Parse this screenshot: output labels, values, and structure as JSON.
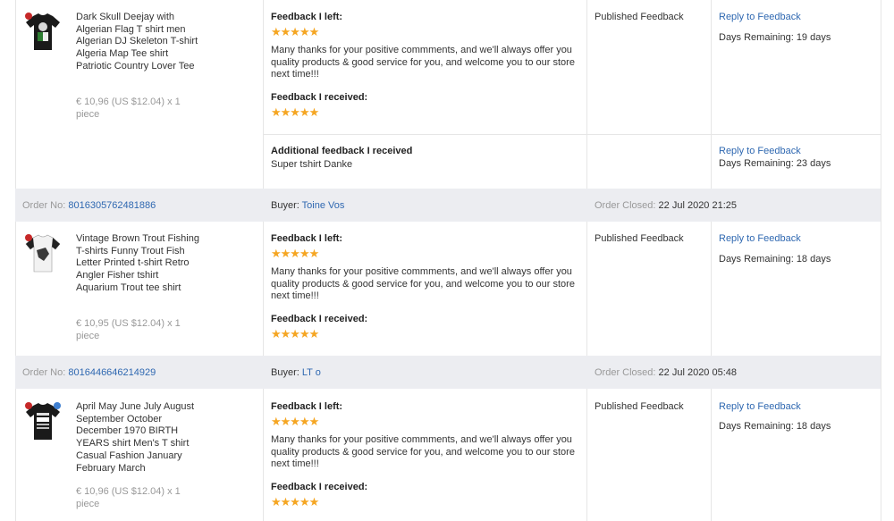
{
  "blocks": [
    {
      "product": {
        "title": "Dark Skull Deejay with Algerian Flag T shirt men Algerian DJ Skeleton T-shirt Algeria Map Tee shirt Patriotic Country Lover Tee",
        "price": "€ 10,96 (US $12.04) x 1 piece",
        "icon": "black-tshirt-skull-print"
      },
      "feedback_left_label": "Feedback I left:",
      "feedback_left_stars": "★★★★★",
      "feedback_left_text": "Many thanks for your positive commments, and we'll always offer you quality products & good service for you, and welcome you to our store next time!!!",
      "feedback_received_label": "Feedback I received:",
      "feedback_received_stars": "★★★★★",
      "status": "Published Feedback",
      "reply_label": "Reply to Feedback",
      "days_remaining": "Days Remaining: 19 days",
      "additional": {
        "label": "Additional feedback I received",
        "text": "Super tshirt Danke",
        "reply_label": "Reply to Feedback",
        "days_remaining": "Days Remaining: 23 days"
      }
    },
    {
      "order": {
        "label": "Order No:",
        "number": "8016305762481886",
        "buyer_label": "Buyer:",
        "buyer": "Toine Vos",
        "closed_label": "Order Closed:",
        "closed_date": "22 Jul 2020 21:25"
      },
      "product": {
        "title": "Vintage Brown Trout Fishing T-shirts Funny Trout Fish Letter Printed t-shirt Retro Angler Fisher tshirt Aquarium Trout tee shirt",
        "price": "€ 10,95 (US $12.04) x 1 piece",
        "icon": "raglan-tshirt-fish-print"
      },
      "feedback_left_label": "Feedback I left:",
      "feedback_left_stars": "★★★★★",
      "feedback_left_text": "Many thanks for your positive commments, and we'll always offer you quality products & good service for you, and welcome you to our store next time!!!",
      "feedback_received_label": "Feedback I received:",
      "feedback_received_stars": "★★★★★",
      "status": "Published Feedback",
      "reply_label": "Reply to Feedback",
      "days_remaining": "Days Remaining: 18 days"
    },
    {
      "order": {
        "label": "Order No:",
        "number": "8016446646214929",
        "buyer_label": "Buyer:",
        "buyer": "LT o",
        "closed_label": "Order Closed:",
        "closed_date": "22 Jul 2020 05:48"
      },
      "product": {
        "title": "April May June July August September October December 1970 BIRTH YEARS shirt Men's T shirt Casual Fashion January February March",
        "price": "€ 10,96 (US $12.04) x 1 piece",
        "icon": "black-tshirt-1970-print"
      },
      "feedback_left_label": "Feedback I left:",
      "feedback_left_stars": "★★★★★",
      "feedback_left_text": "Many thanks for your positive commments, and we'll always offer you quality products & good service for you, and welcome you to our store next time!!!",
      "feedback_received_label": "Feedback I received:",
      "feedback_received_stars": "★★★★★",
      "status": "Published Feedback",
      "reply_label": "Reply to Feedback",
      "days_remaining": "Days Remaining: 18 days"
    }
  ],
  "colors": {
    "link": "#2f68b1",
    "star": "#f5a623",
    "order_bar": "#ecedf1",
    "muted": "#999999"
  }
}
